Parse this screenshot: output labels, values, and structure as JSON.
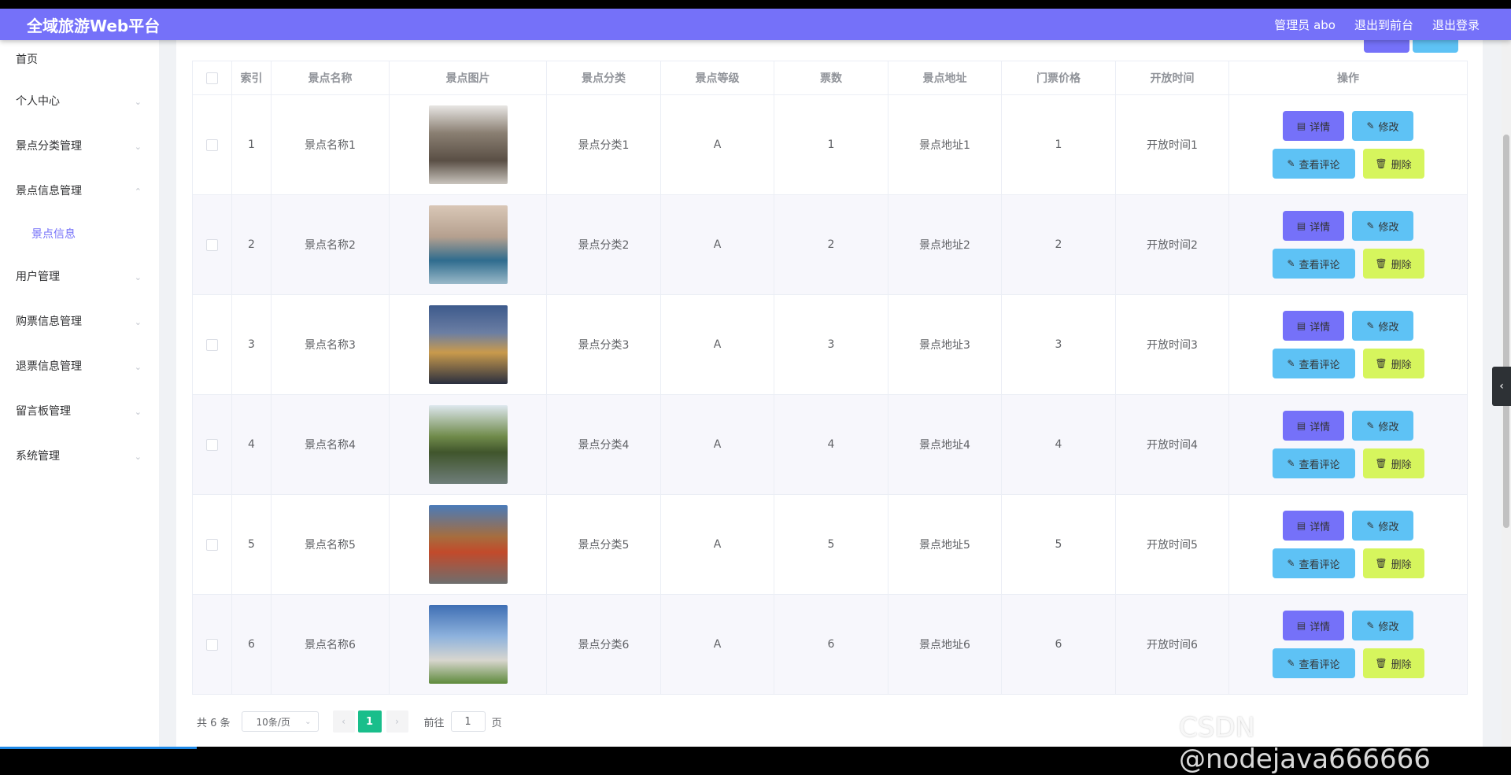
{
  "app": {
    "title": "全域旅游Web平台",
    "user": "管理员 abo",
    "to_front": "退出到前台",
    "logout": "退出登录"
  },
  "sidebar": {
    "items": [
      {
        "label": "首页"
      },
      {
        "label": "个人中心"
      },
      {
        "label": "景点分类管理"
      },
      {
        "label": "景点信息管理",
        "expanded": true,
        "children": [
          {
            "label": "景点信息"
          }
        ]
      },
      {
        "label": "用户管理"
      },
      {
        "label": "购票信息管理"
      },
      {
        "label": "退票信息管理"
      },
      {
        "label": "留言板管理"
      },
      {
        "label": "系统管理"
      }
    ]
  },
  "table": {
    "columns": [
      "索引",
      "景点名称",
      "景点图片",
      "景点分类",
      "景点等级",
      "票数",
      "景点地址",
      "门票价格",
      "开放时间",
      "操作"
    ],
    "rows": [
      {
        "index": "1",
        "name": "景点名称1",
        "category": "景点分类1",
        "level": "A",
        "tickets": "1",
        "address": "景点地址1",
        "price": "1",
        "open": "开放时间1"
      },
      {
        "index": "2",
        "name": "景点名称2",
        "category": "景点分类2",
        "level": "A",
        "tickets": "2",
        "address": "景点地址2",
        "price": "2",
        "open": "开放时间2"
      },
      {
        "index": "3",
        "name": "景点名称3",
        "category": "景点分类3",
        "level": "A",
        "tickets": "3",
        "address": "景点地址3",
        "price": "3",
        "open": "开放时间3"
      },
      {
        "index": "4",
        "name": "景点名称4",
        "category": "景点分类4",
        "level": "A",
        "tickets": "4",
        "address": "景点地址4",
        "price": "4",
        "open": "开放时间4"
      },
      {
        "index": "5",
        "name": "景点名称5",
        "category": "景点分类5",
        "level": "A",
        "tickets": "5",
        "address": "景点地址5",
        "price": "5",
        "open": "开放时间5"
      },
      {
        "index": "6",
        "name": "景点名称6",
        "category": "景点分类6",
        "level": "A",
        "tickets": "6",
        "address": "景点地址6",
        "price": "6",
        "open": "开放时间6"
      }
    ],
    "actions": {
      "detail": "详情",
      "edit": "修改",
      "review": "查看评论",
      "delete": "删除"
    }
  },
  "pagination": {
    "total": "共 6 条",
    "page_size": "10条/页",
    "current": "1",
    "goto_prefix": "前往",
    "goto_value": "1",
    "goto_suffix": "页"
  },
  "watermark": "CSDN @nodejava666666",
  "colors": {
    "topbar": "#7571f9",
    "detail_button": "#7571f9",
    "edit_button": "#5ec2f5",
    "delete_button": "#d6f55d",
    "page_active": "#19be8b"
  }
}
